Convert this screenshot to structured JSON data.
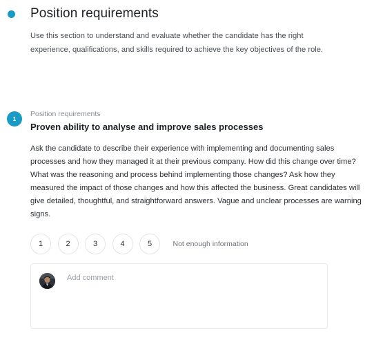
{
  "section": {
    "title": "Position requirements",
    "description": "Use this section to understand and evaluate whether the candidate has the right experience, qualifications, and skills required to achieve the key objectives of the role."
  },
  "question": {
    "number": "1",
    "category": "Position requirements",
    "title": "Proven ability to analyse and improve sales processes",
    "body": "Ask the candidate to describe their experience with implementing and documenting sales processes and how they managed it at their previous company. How did this change over time? What was the reasoning and process behind implementing those changes? Ask how they measured the impact of those changes and how this affected the business. Great candidates will give detailed, thoughtful, and straightforward answers. Vague and unclear processes are warning signs."
  },
  "rating": {
    "options": [
      "1",
      "2",
      "3",
      "4",
      "5"
    ],
    "not_enough_label": "Not enough information"
  },
  "comment": {
    "placeholder": "Add comment",
    "value": ""
  },
  "colors": {
    "accent": "#1a9bc6"
  }
}
